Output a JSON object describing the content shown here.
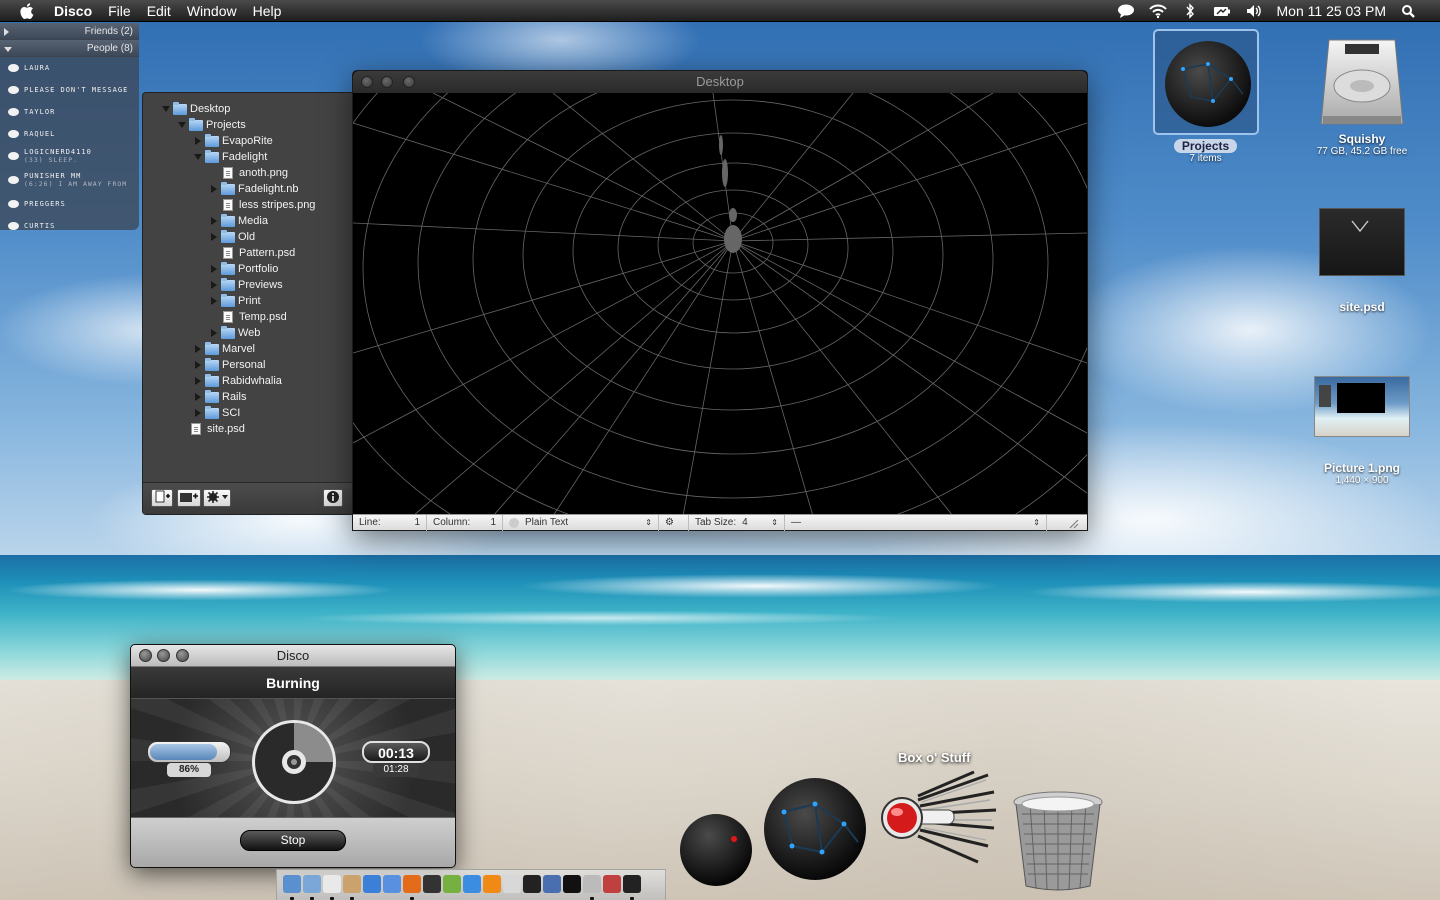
{
  "menubar": {
    "app_name": "Disco",
    "menus": [
      "File",
      "Edit",
      "Window",
      "Help"
    ],
    "clock": "Mon 11 25 03 PM",
    "status_icons": [
      "chat-bubble-icon",
      "wifi-icon",
      "bluetooth-icon",
      "battery-icon",
      "volume-icon",
      "spotlight-icon"
    ]
  },
  "buddylist": {
    "groups": [
      {
        "label": "Friends (2)",
        "expanded": false
      },
      {
        "label": "People (8)",
        "expanded": true
      }
    ],
    "buddies": [
      {
        "name": "Laura",
        "status": ""
      },
      {
        "name": "Please don't message",
        "status": ""
      },
      {
        "name": "Taylor",
        "status": ""
      },
      {
        "name": "Raquel",
        "status": ""
      },
      {
        "name": "logicnerd4110",
        "status": "(33) sleep."
      },
      {
        "name": "Punisher MM",
        "status": "(6:26) I am away from"
      },
      {
        "name": "preggers",
        "status": ""
      },
      {
        "name": "Curtis",
        "status": ""
      }
    ]
  },
  "drawer": {
    "tree": [
      {
        "label": "Desktop",
        "type": "folder",
        "depth": 0,
        "state": "open"
      },
      {
        "label": "Projects",
        "type": "folder",
        "depth": 1,
        "state": "open"
      },
      {
        "label": "EvapoRite",
        "type": "folder",
        "depth": 2,
        "state": "closed"
      },
      {
        "label": "Fadelight",
        "type": "folder",
        "depth": 2,
        "state": "open"
      },
      {
        "label": "anoth.png",
        "type": "file",
        "depth": 3,
        "state": "none"
      },
      {
        "label": "Fadelight.nb",
        "type": "folder",
        "depth": 3,
        "state": "closed"
      },
      {
        "label": "less stripes.png",
        "type": "file",
        "depth": 3,
        "state": "none"
      },
      {
        "label": "Media",
        "type": "folder",
        "depth": 3,
        "state": "closed"
      },
      {
        "label": "Old",
        "type": "folder",
        "depth": 3,
        "state": "closed"
      },
      {
        "label": "Pattern.psd",
        "type": "file",
        "depth": 3,
        "state": "none"
      },
      {
        "label": "Portfolio",
        "type": "folder",
        "depth": 3,
        "state": "closed"
      },
      {
        "label": "Previews",
        "type": "folder",
        "depth": 3,
        "state": "closed"
      },
      {
        "label": "Print",
        "type": "folder",
        "depth": 3,
        "state": "closed"
      },
      {
        "label": "Temp.psd",
        "type": "file",
        "depth": 3,
        "state": "none"
      },
      {
        "label": "Web",
        "type": "folder",
        "depth": 3,
        "state": "closed"
      },
      {
        "label": "Marvel",
        "type": "folder",
        "depth": 2,
        "state": "closed"
      },
      {
        "label": "Personal",
        "type": "folder",
        "depth": 2,
        "state": "closed"
      },
      {
        "label": "Rabidwhalia",
        "type": "folder",
        "depth": 2,
        "state": "closed"
      },
      {
        "label": "Rails",
        "type": "folder",
        "depth": 2,
        "state": "closed"
      },
      {
        "label": "SCI",
        "type": "folder",
        "depth": 2,
        "state": "closed"
      },
      {
        "label": "site.psd",
        "type": "file",
        "depth": 1,
        "state": "none"
      }
    ],
    "toolbar": {
      "new_file_icon": "new-file-icon",
      "new_folder_icon": "new-folder-icon",
      "action_icon": "gear-icon",
      "info_icon": "info-icon"
    }
  },
  "editor": {
    "title": "Desktop",
    "status": {
      "line_label": "Line:",
      "line_value": "1",
      "column_label": "Column:",
      "column_value": "1",
      "syntax": "Plain Text",
      "tab_size_label": "Tab Size:",
      "tab_size_value": "4",
      "symbol": "—"
    }
  },
  "desktop_icons": [
    {
      "name": "Projects",
      "sub": "7 items",
      "selected": true
    },
    {
      "name": "Squishy",
      "sub": "77 GB, 45.2 GB free",
      "selected": false
    },
    {
      "name": "site.psd",
      "sub": "",
      "selected": false
    },
    {
      "name": "Picture 1.png",
      "sub": "1,440 × 900",
      "selected": false
    }
  ],
  "disco": {
    "title": "Disco",
    "state": "Burning",
    "progress_label": "86%",
    "progress_value": 0.86,
    "elapsed": "00:13",
    "total": "01:28",
    "stop_label": "Stop"
  },
  "dock_stack_label": "Box o' Stuff",
  "dock": {
    "items": [
      "finder-icon",
      "mail-icon",
      "ical-icon",
      "addressbook-icon",
      "safari-icon",
      "network-icon",
      "firefox-icon",
      "ink-icon",
      "adium-icon",
      "itunes-icon",
      "vlc-icon",
      "preview-icon",
      "keyboard-icon",
      "pen-icon",
      "dvd-icon",
      "cube-icon",
      "photo-icon",
      "terminal-icon"
    ],
    "running": [
      0,
      1,
      2,
      3,
      6,
      15,
      17
    ]
  },
  "colors": {
    "menubar_bg": "#2a2a2a",
    "editor_bg": "#000000",
    "drawer_bg": "#434343",
    "accent_blue": "#2ea4ff"
  }
}
